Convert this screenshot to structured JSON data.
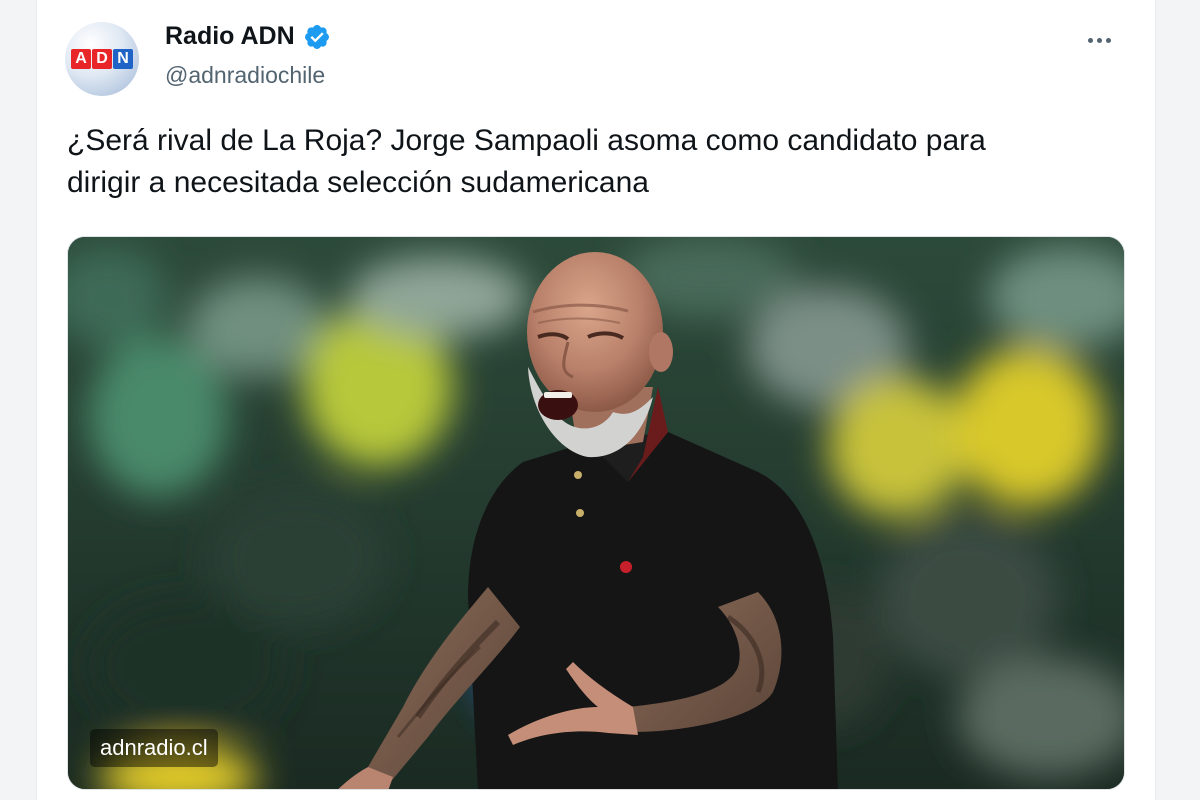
{
  "author": {
    "avatar_icon": "adn-logo-avatar",
    "avatar_letters": [
      "A",
      "D",
      "N"
    ],
    "name": "Radio ADN",
    "verified_icon": "verified-badge-icon",
    "handle": "@adnradiochile"
  },
  "more_icon": "more-options-icon",
  "tweet": {
    "text_line1": "¿Será rival de La Roja? Jorge Sampaoli asoma como candidato para",
    "text_line2": "dirigir a necesitada selección sudamericana"
  },
  "media": {
    "watermark": "adnradio.cl"
  },
  "colors": {
    "name": "#0f1419",
    "handle": "#536471",
    "verified": "#1d9bf0",
    "logo_red": "#e8262a",
    "logo_blue": "#1f63c6"
  }
}
